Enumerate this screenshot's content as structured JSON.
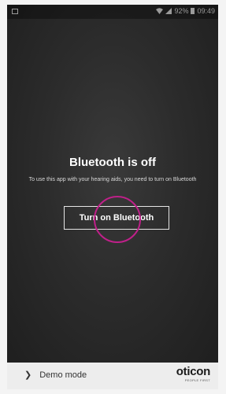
{
  "status_bar": {
    "battery": "92%",
    "time": "09:49",
    "battery_level": 0.92
  },
  "main": {
    "title": "Bluetooth is off",
    "subtitle": "To use this app with your hearing aids, you need to turn on Bluetooth",
    "button_label": "Turn on Bluetooth"
  },
  "footer": {
    "demo_label": "Demo mode",
    "logo_text": "oticon",
    "logo_tagline": "PEOPLE FIRST"
  },
  "colors": {
    "highlight": "#c0208a",
    "screen_bg": "#2c2c2c"
  }
}
